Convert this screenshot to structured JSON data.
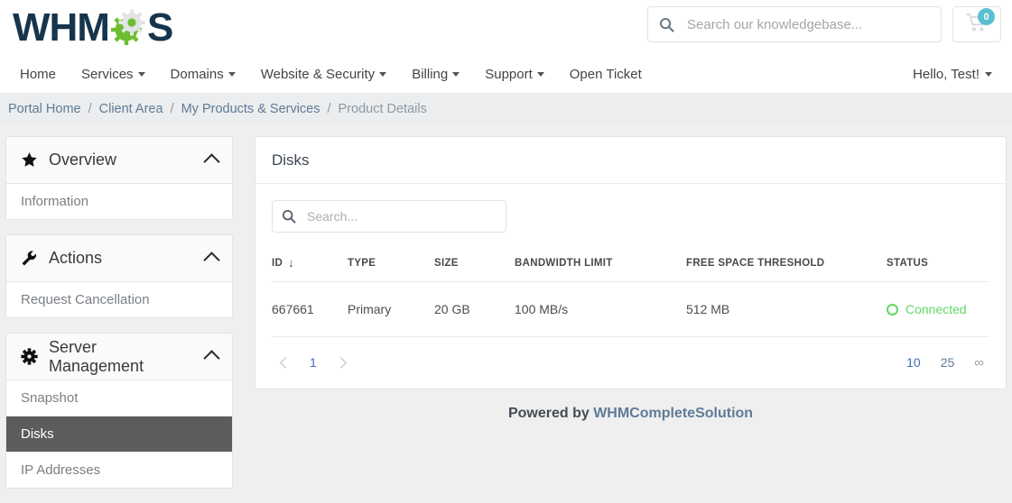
{
  "header": {
    "logo_text_1": "WHM",
    "logo_text_2": "S",
    "logo_icon": "gear-icon",
    "search": {
      "placeholder": "Search our knowledgebase...",
      "value": "",
      "icon": "search-icon"
    },
    "cart": {
      "icon": "shopping-cart-icon",
      "badge_count": "0",
      "badge_color": "#59bfd0"
    }
  },
  "nav": {
    "items": [
      {
        "label": "Home",
        "has_caret": false
      },
      {
        "label": "Services",
        "has_caret": true
      },
      {
        "label": "Domains",
        "has_caret": true
      },
      {
        "label": "Website & Security",
        "has_caret": true
      },
      {
        "label": "Billing",
        "has_caret": true
      },
      {
        "label": "Support",
        "has_caret": true
      },
      {
        "label": "Open Ticket",
        "has_caret": false
      }
    ],
    "account_label": "Hello, Test!"
  },
  "breadcrumb": {
    "items": [
      "Portal Home",
      "Client Area",
      "My Products & Services",
      "Product Details"
    ],
    "separator": "/"
  },
  "sidebar": {
    "panels": [
      {
        "title": "Overview",
        "icon": "star-icon",
        "toggle_icon": "chevron-up-icon",
        "links": [
          {
            "label": "Information",
            "active": false
          }
        ]
      },
      {
        "title": "Actions",
        "icon": "wrench-icon",
        "toggle_icon": "chevron-up-icon",
        "links": [
          {
            "label": "Request Cancellation",
            "active": false
          }
        ]
      },
      {
        "title": "Server Management",
        "icon": "gear-icon",
        "toggle_icon": "chevron-up-icon",
        "links": [
          {
            "label": "Snapshot",
            "active": false
          },
          {
            "label": "Disks",
            "active": true
          },
          {
            "label": "IP Addresses",
            "active": false
          }
        ]
      }
    ]
  },
  "main": {
    "card_title": "Disks",
    "search": {
      "placeholder": "Search...",
      "value": "",
      "icon": "search-icon"
    },
    "table": {
      "columns": [
        {
          "label": "ID",
          "sorted": true,
          "sort_icon": "arrow-down-icon"
        },
        {
          "label": "TYPE",
          "sorted": false
        },
        {
          "label": "SIZE",
          "sorted": false
        },
        {
          "label": "BANDWIDTH LIMIT",
          "sorted": false
        },
        {
          "label": "FREE SPACE THRESHOLD",
          "sorted": false
        },
        {
          "label": "STATUS",
          "sorted": false
        }
      ],
      "rows": [
        {
          "id": "667661",
          "type": "Primary",
          "size": "20 GB",
          "bandwidth_limit": "100 MB/s",
          "free_space_threshold": "512 MB",
          "status": "Connected",
          "status_color": "#62d862",
          "status_icon": "circle-outline-icon"
        }
      ]
    },
    "pagination": {
      "prev_icon": "chevron-left-icon",
      "next_icon": "chevron-right-icon",
      "current_page": "1",
      "page_sizes": [
        {
          "label": "10",
          "active": true
        },
        {
          "label": "25",
          "active": false
        },
        {
          "label": "∞",
          "active": false
        }
      ]
    }
  },
  "footer": {
    "powered_by": "Powered by ",
    "brand": "WHMCompleteSolution"
  }
}
